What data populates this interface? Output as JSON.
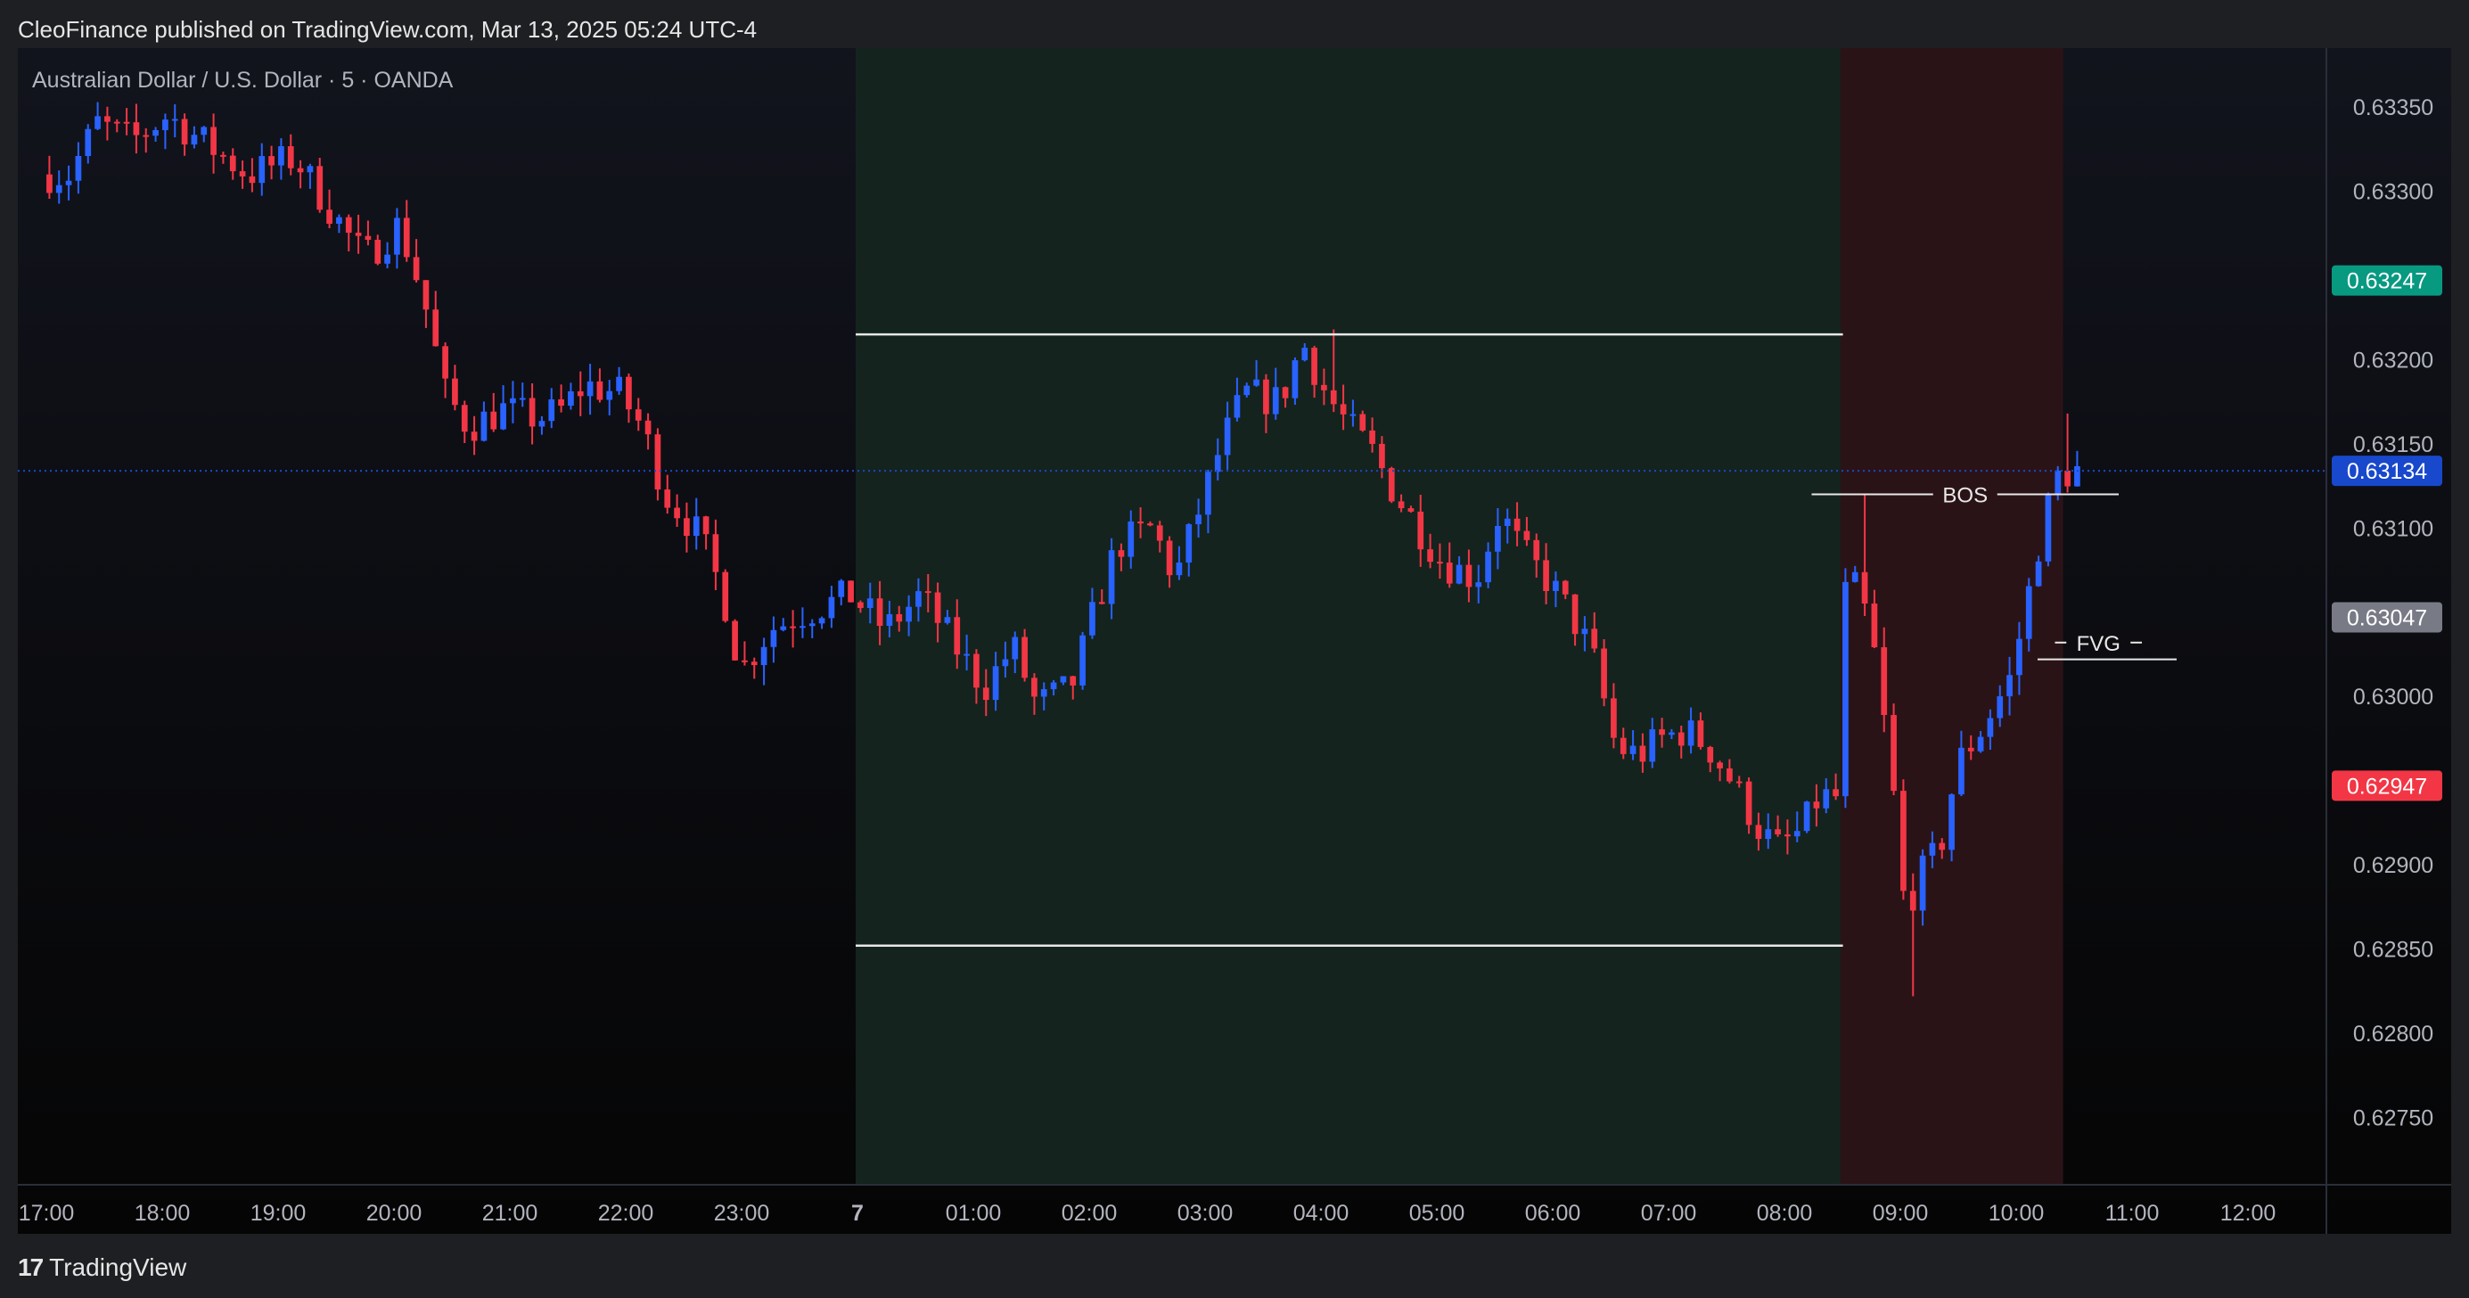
{
  "header": {
    "caption": "CleoFinance published on TradingView.com, Mar 13, 2025 05:24 UTC-4"
  },
  "footer": {
    "brand": "TradingView",
    "logo_icon": "tradingview-logo-icon"
  },
  "colors": {
    "up": "#2962ff",
    "down": "#f23645",
    "asia_session": "#14231e",
    "london_session": "#2a1317",
    "current_price": "#1848cc",
    "last_up": "#089981",
    "last_down": "#f23645",
    "gray": "#787b86"
  },
  "chart_data": {
    "type": "candlestick",
    "title": "Australian Dollar / U.S. Dollar · 5 · OANDA",
    "ylim": [
      0.6271,
      0.63385
    ],
    "y_ticks": [
      0.6335,
      0.633,
      0.632,
      0.6315,
      0.631,
      0.63,
      0.629,
      0.6285,
      0.628,
      0.6275
    ],
    "y_tick_labels": [
      "0.63350",
      "0.63300",
      "0.63200",
      "0.63150",
      "0.63100",
      "0.63000",
      "0.62900",
      "0.62850",
      "0.62800",
      "0.62750"
    ],
    "x_ticks": [
      {
        "t": 0,
        "label": "17:00"
      },
      {
        "t": 1,
        "label": "18:00"
      },
      {
        "t": 2,
        "label": "19:00"
      },
      {
        "t": 3,
        "label": "20:00"
      },
      {
        "t": 4,
        "label": "21:00"
      },
      {
        "t": 5,
        "label": "22:00"
      },
      {
        "t": 6,
        "label": "23:00"
      },
      {
        "t": 7,
        "label": "7"
      },
      {
        "t": 8,
        "label": "01:00"
      },
      {
        "t": 9,
        "label": "02:00"
      },
      {
        "t": 10,
        "label": "03:00"
      },
      {
        "t": 11,
        "label": "04:00"
      },
      {
        "t": 12,
        "label": "05:00"
      },
      {
        "t": 13,
        "label": "06:00"
      },
      {
        "t": 14,
        "label": "07:00"
      },
      {
        "t": 15,
        "label": "08:00"
      },
      {
        "t": 16,
        "label": "09:00"
      },
      {
        "t": 17,
        "label": "10:00"
      },
      {
        "t": 18,
        "label": "11:00"
      },
      {
        "t": 19,
        "label": "12:00"
      }
    ],
    "xlim": [
      0,
      20.5
    ],
    "price_labels": [
      {
        "value": 0.63247,
        "label": "0.63247",
        "color": "#089981"
      },
      {
        "value": 0.63134,
        "label": "0.63134",
        "color": "#1848cc"
      },
      {
        "value": 0.63047,
        "label": "0.63047",
        "color": "#787b86"
      },
      {
        "value": 0.62947,
        "label": "0.62947",
        "color": "#f23645"
      }
    ],
    "current_price": 0.63134,
    "sessions": [
      {
        "start": 7.0,
        "end": 15.5,
        "color": "#14231e"
      },
      {
        "start": 15.5,
        "end": 17.42,
        "color": "#2a1317"
      }
    ],
    "levels": [
      {
        "price": 0.63215,
        "start": 7.0,
        "end": 15.52
      },
      {
        "price": 0.62852,
        "start": 7.0,
        "end": 15.52
      }
    ],
    "annotations": [
      {
        "label": "BOS",
        "price": 0.6312,
        "start": 15.25,
        "end": 17.9
      },
      {
        "label": "FVG",
        "price": 0.63032,
        "start": 17.35,
        "end": 18.1
      },
      {
        "label": "",
        "price": 0.63022,
        "start": 17.2,
        "end": 18.4
      }
    ],
    "anchors": [
      [
        0.0,
        0.6331
      ],
      [
        0.25,
        0.6331
      ],
      [
        0.5,
        0.6334
      ],
      [
        0.8,
        0.6333
      ],
      [
        1.1,
        0.63345
      ],
      [
        1.4,
        0.6333
      ],
      [
        1.8,
        0.6331
      ],
      [
        2.2,
        0.6332
      ],
      [
        2.5,
        0.6329
      ],
      [
        2.8,
        0.6326
      ],
      [
        3.1,
        0.6328
      ],
      [
        3.3,
        0.6324
      ],
      [
        3.5,
        0.6318
      ],
      [
        3.7,
        0.6316
      ],
      [
        4.0,
        0.6317
      ],
      [
        4.3,
        0.63165
      ],
      [
        4.5,
        0.6317
      ],
      [
        4.7,
        0.63185
      ],
      [
        5.0,
        0.6318
      ],
      [
        5.2,
        0.6316
      ],
      [
        5.4,
        0.6312
      ],
      [
        5.7,
        0.63095
      ],
      [
        5.9,
        0.6306
      ],
      [
        6.05,
        0.63015
      ],
      [
        6.3,
        0.6304
      ],
      [
        6.6,
        0.6305
      ],
      [
        7.0,
        0.6306
      ],
      [
        7.3,
        0.6304
      ],
      [
        7.6,
        0.6306
      ],
      [
        7.9,
        0.6303
      ],
      [
        8.15,
        0.63005
      ],
      [
        8.4,
        0.6303
      ],
      [
        8.6,
        0.62995
      ],
      [
        8.9,
        0.63005
      ],
      [
        9.1,
        0.6305
      ],
      [
        9.3,
        0.6309
      ],
      [
        9.6,
        0.631
      ],
      [
        9.8,
        0.6307
      ],
      [
        10.0,
        0.6311
      ],
      [
        10.2,
        0.6315
      ],
      [
        10.4,
        0.6318
      ],
      [
        10.7,
        0.63175
      ],
      [
        10.9,
        0.6321
      ],
      [
        11.1,
        0.6318
      ],
      [
        11.3,
        0.6316
      ],
      [
        11.5,
        0.63145
      ],
      [
        11.7,
        0.6312
      ],
      [
        11.9,
        0.631
      ],
      [
        12.1,
        0.6308
      ],
      [
        12.4,
        0.6307
      ],
      [
        12.6,
        0.6311
      ],
      [
        12.8,
        0.63085
      ],
      [
        13.0,
        0.6307
      ],
      [
        13.2,
        0.6305
      ],
      [
        13.4,
        0.63025
      ],
      [
        13.6,
        0.6297
      ],
      [
        13.8,
        0.62965
      ],
      [
        14.0,
        0.62975
      ],
      [
        14.2,
        0.6298
      ],
      [
        14.4,
        0.6297
      ],
      [
        14.6,
        0.6295
      ],
      [
        14.85,
        0.6292
      ],
      [
        15.0,
        0.6291
      ],
      [
        15.2,
        0.6292
      ],
      [
        15.35,
        0.6294
      ],
      [
        15.5,
        0.6294
      ],
      [
        15.55,
        0.6306
      ],
      [
        15.7,
        0.63065
      ],
      [
        15.85,
        0.6302
      ],
      [
        16.0,
        0.6294
      ],
      [
        16.1,
        0.6287
      ],
      [
        16.2,
        0.6289
      ],
      [
        16.4,
        0.6291
      ],
      [
        16.55,
        0.6296
      ],
      [
        16.75,
        0.6298
      ],
      [
        17.0,
        0.6301
      ],
      [
        17.1,
        0.6304
      ],
      [
        17.25,
        0.6309
      ],
      [
        17.4,
        0.6313
      ],
      [
        17.55,
        0.63134
      ]
    ],
    "wick_extremes": [
      {
        "t": 11.1,
        "high": 0.63218
      },
      {
        "t": 16.12,
        "low": 0.62822
      },
      {
        "t": 17.45,
        "high": 0.63168
      },
      {
        "t": 15.7,
        "high": 0.6312
      }
    ]
  }
}
